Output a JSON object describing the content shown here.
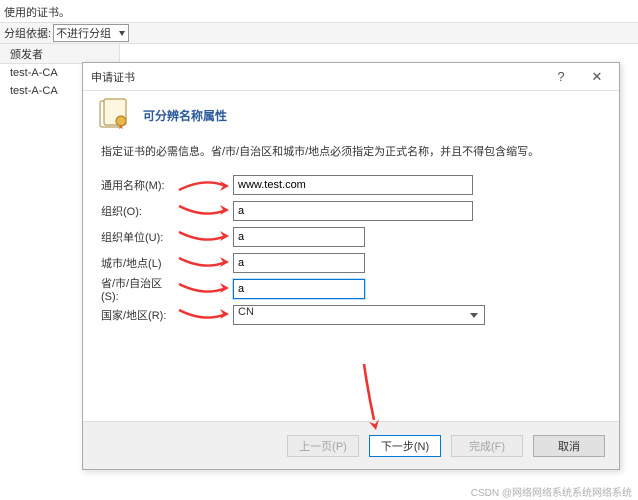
{
  "background": {
    "used_cert_label": "使用的证书。",
    "grouping_label": "分组依据:",
    "grouping_value": "不进行分组",
    "column_header": "颁发者",
    "items": [
      "test-A-CA",
      "test-A-CA"
    ]
  },
  "dialog": {
    "title": "申请证书",
    "help": "?",
    "close": "✕",
    "header_title": "可分辨名称属性",
    "description": "指定证书的必需信息。省/市/自治区和城市/地点必须指定为正式名称，并且不得包含缩写。",
    "fields": {
      "common_name": {
        "label": "通用名称(M):",
        "value": "www.test.com"
      },
      "org": {
        "label": "组织(O):",
        "value": "a"
      },
      "org_unit": {
        "label": "组织单位(U):",
        "value": "a"
      },
      "city": {
        "label": "城市/地点(L)",
        "value": "a"
      },
      "state": {
        "label": "省/市/自治区(S):",
        "value": "a"
      },
      "country": {
        "label": "国家/地区(R):",
        "value": "CN"
      }
    },
    "buttons": {
      "prev": "上一页(P)",
      "next": "下一步(N)",
      "finish": "完成(F)",
      "cancel": "取消"
    }
  },
  "footer": "CSDN @网络网络系统系统网络系统"
}
